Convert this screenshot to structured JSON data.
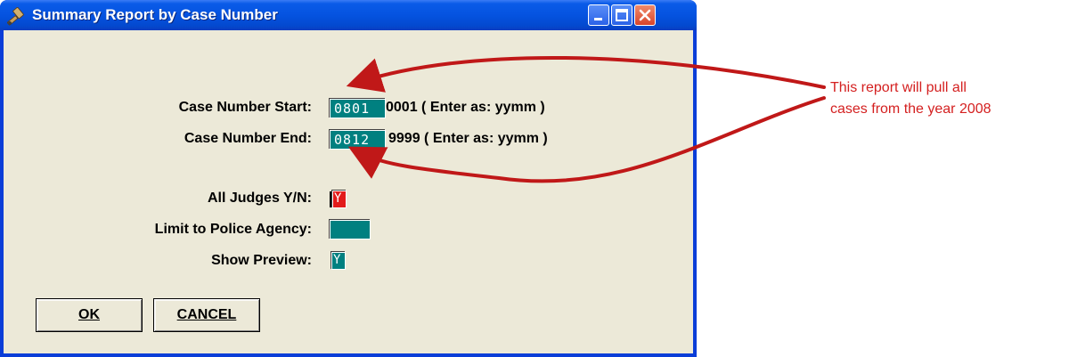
{
  "window": {
    "title": "Summary Report by Case Number",
    "icon": "gavel-icon"
  },
  "titlebar_buttons": {
    "minimize": "minimize-icon",
    "maximize": "maximize-icon",
    "close": "close-icon"
  },
  "form": {
    "case_start": {
      "label": "Case Number Start:",
      "value": "0801",
      "suffix": "0001 ( Enter as: yymm )"
    },
    "case_end": {
      "label": "Case Number End:",
      "value": "0812",
      "suffix": "9999 ( Enter as: yymm )"
    },
    "all_judges": {
      "label": "All Judges Y/N:",
      "value": "Y"
    },
    "police_agency": {
      "label": "Limit to Police Agency:",
      "value": ""
    },
    "show_preview": {
      "label": "Show Preview:",
      "value": "Y"
    }
  },
  "buttons": {
    "ok": "OK",
    "cancel": "CANCEL"
  },
  "annotation": {
    "line1": "This report will pull all",
    "line2": "cases from the year 2008",
    "color": "#d42020"
  },
  "colors": {
    "field_bg": "#008080",
    "active_field_bg": "#e21b1b",
    "titlebar": "#0553e0",
    "client_bg": "#ece9d8"
  }
}
